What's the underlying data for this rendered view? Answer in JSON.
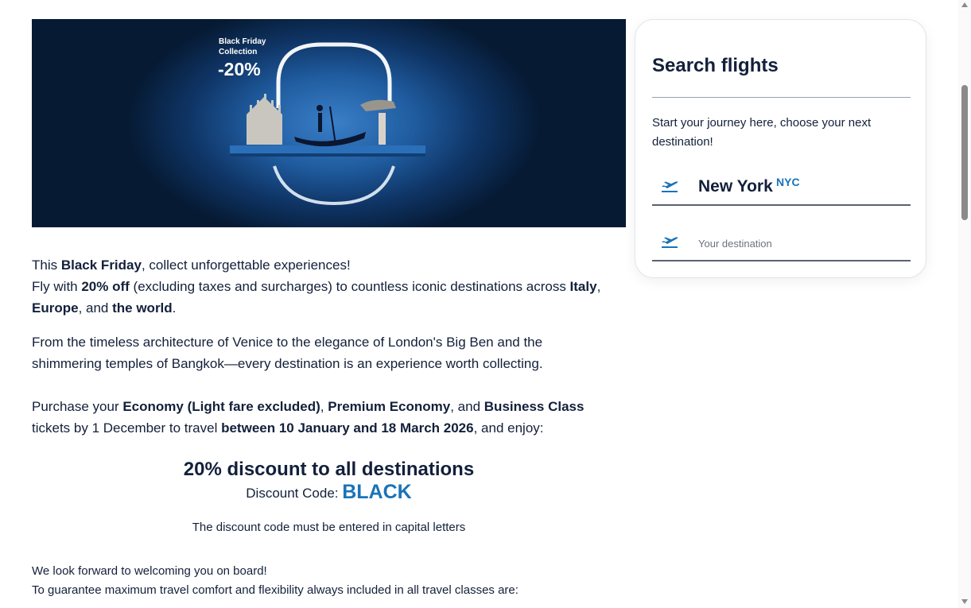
{
  "banner": {
    "label_line1": "Black Friday",
    "label_line2": "Collection",
    "discount": "-20%"
  },
  "content": {
    "p1": {
      "t1": "This ",
      "b1": "Black Friday",
      "t2": ", collect unforgettable experiences!",
      "t3": "Fly with ",
      "b2": "20% off",
      "t4": " (excluding taxes and surcharges) to countless iconic destinations across ",
      "b3": "Italy",
      "t5": ", ",
      "b4": "Europe",
      "t6": ", and ",
      "b5": "the world",
      "t7": "."
    },
    "p2": "From the timeless architecture of Venice to the elegance of London's Big Ben and the shimmering temples of Bangkok—every destination is an experience worth collecting.",
    "p3": {
      "t1": "Purchase your ",
      "b1": "Economy (Light fare excluded)",
      "t2": ", ",
      "b2": "Premium Economy",
      "t3": ", and ",
      "b3": "Business Class",
      "t4": " tickets by 1 December to travel ",
      "b4": "between 10 January and 18 March 2026",
      "t5": ", and enjoy:"
    },
    "promo_title": "20% discount to all destinations",
    "promo_code_label": "Discount Code: ",
    "promo_code": "BLACK",
    "promo_note": "The discount code must be entered in capital letters",
    "closing1": "We look forward to welcoming you on board!",
    "closing2": "To guarantee maximum travel comfort and flexibility always included in all travel classes are:"
  },
  "search": {
    "title": "Search flights",
    "description": "Start your journey here, choose your next destination!",
    "origin_city": "New York",
    "origin_code": "NYC",
    "destination_placeholder": "Your destination",
    "destination_value": ""
  },
  "colors": {
    "accent": "#1a73b8",
    "text": "#13203a",
    "banner_dark": "#061a33"
  },
  "icons": {
    "takeoff": "airplane-takeoff-icon"
  }
}
